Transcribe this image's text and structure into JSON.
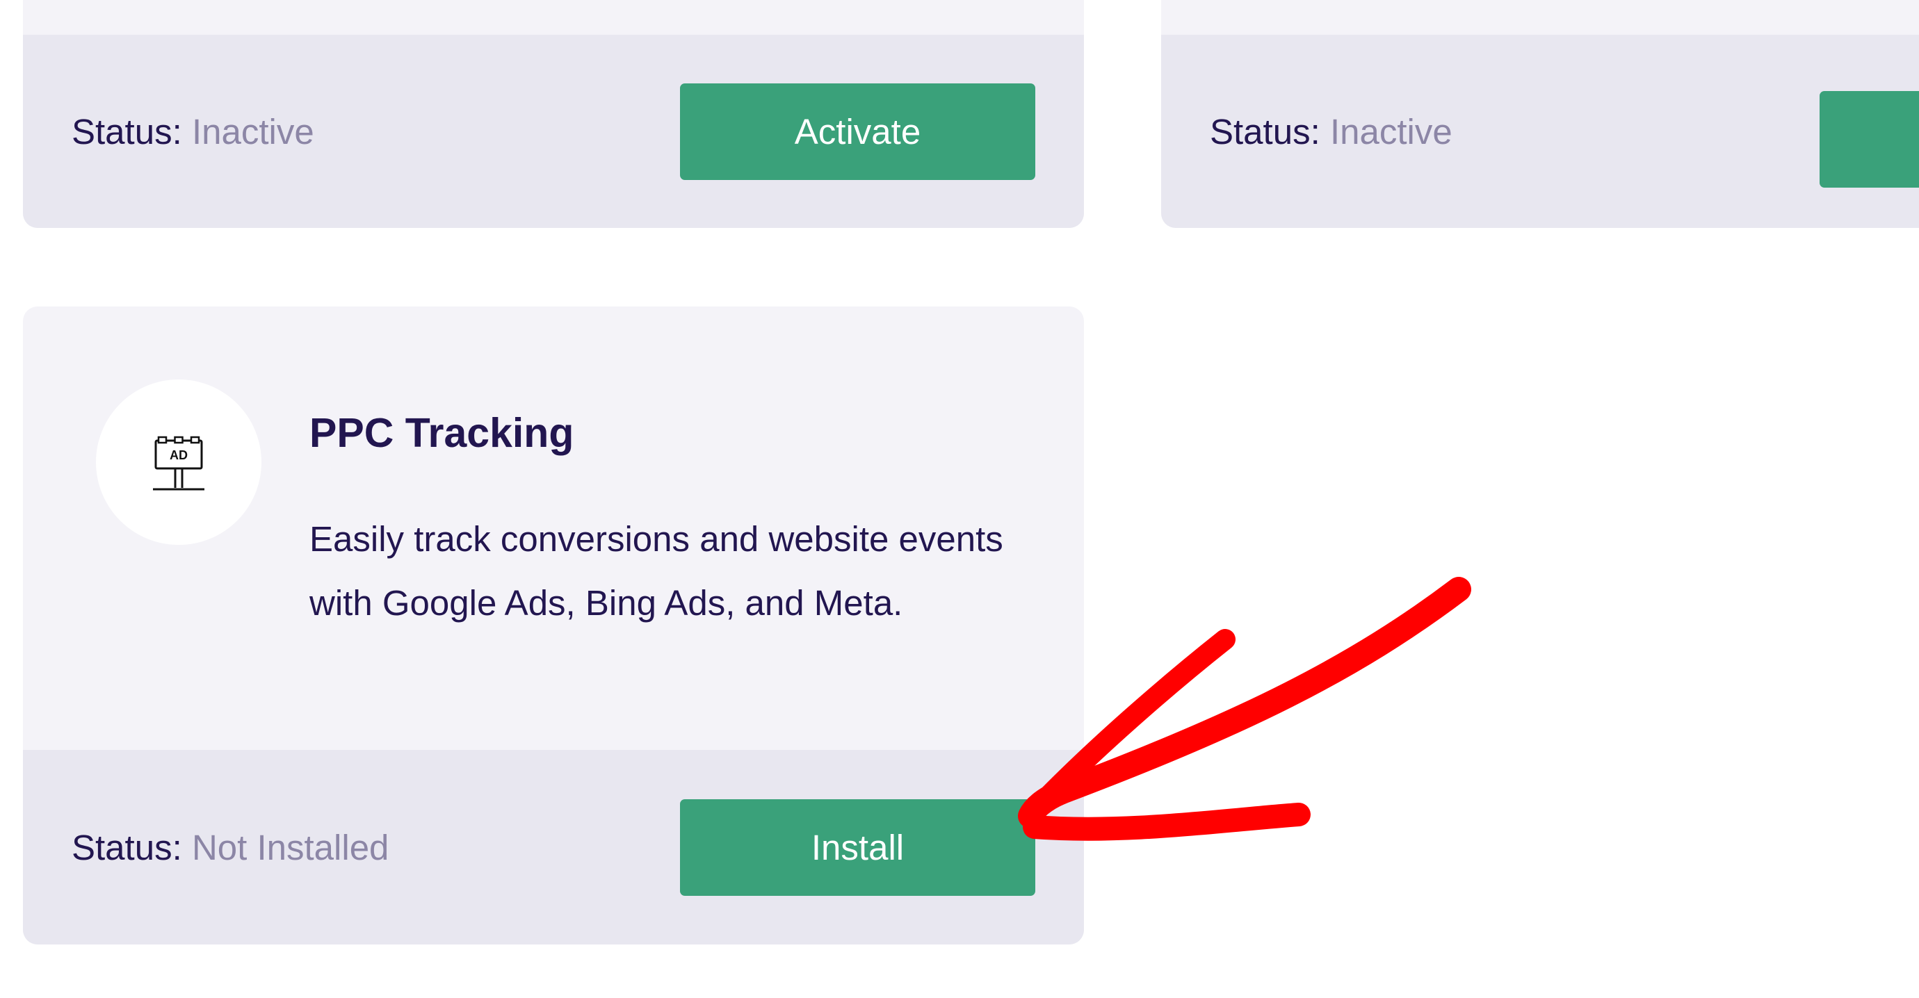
{
  "cards": {
    "top_left": {
      "status_label": "Status:",
      "status_value": "Inactive",
      "button_label": "Activate"
    },
    "top_right": {
      "status_label": "Status:",
      "status_value": "Inactive",
      "button_label": ""
    },
    "ppc": {
      "icon": "ad-billboard-icon",
      "icon_text": "AD",
      "title": "PPC Tracking",
      "description": "Easily track conversions and website events with Google Ads, Bing Ads, and Meta.",
      "status_label": "Status:",
      "status_value": "Not Installed",
      "button_label": "Install"
    }
  },
  "colors": {
    "card_background": "#f4f3f8",
    "footer_background": "#e8e7f0",
    "button_green": "#3aa17a",
    "text_dark": "#221650",
    "text_muted": "#8c86a6",
    "annotation_red": "#ff0000"
  }
}
